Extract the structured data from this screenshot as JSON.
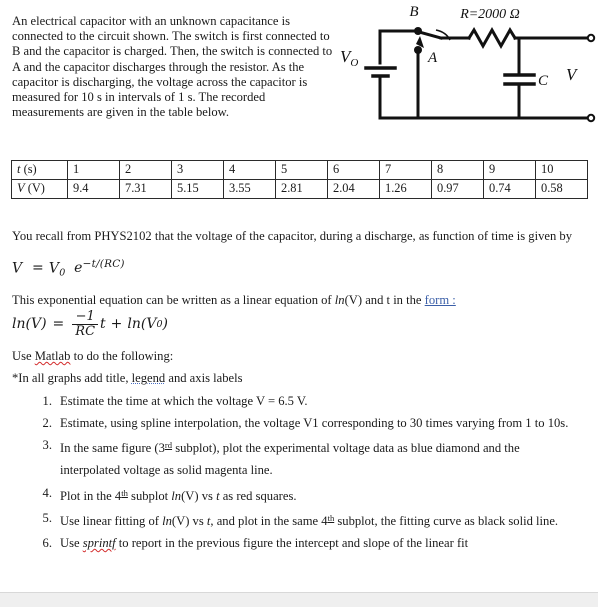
{
  "intro": {
    "paragraph": "An electrical capacitor with an unknown capacitance is connected to the circuit shown. The switch is first connected to B and the capacitor is charged. Then, the switch is connected to A and the capacitor discharges through the resistor. As the capacitor is discharging, the voltage across the capacitor is measured for 10 s in intervals of 1 s. The recorded measurements are given in the table below."
  },
  "circuit": {
    "source_label": "V",
    "source_sub": "O",
    "node_b": "B",
    "node_a": "A",
    "resistor_label": "R=2000 Ω",
    "capacitor_label": "C",
    "output_label": "V"
  },
  "table": {
    "row_headers": [
      "t (s)",
      "V (V)"
    ],
    "time_header_var": "t",
    "time_header_unit": "(s)",
    "volt_header_var": "V",
    "volt_header_unit": "(V)",
    "times": [
      "1",
      "2",
      "3",
      "4",
      "5",
      "6",
      "7",
      "8",
      "9",
      "10"
    ],
    "voltages": [
      "9.4",
      "7.31",
      "5.15",
      "3.55",
      "2.81",
      "2.04",
      "1.26",
      "0.97",
      "0.74",
      "0.58"
    ]
  },
  "text": {
    "recall": "You recall from PHYS2102 that the voltage of the capacitor, during a discharge, as function of time is given by",
    "linear_intro_a": "This exponential equation can be written as a linear equation of ",
    "linear_intro_ln": "ln",
    "linear_intro_b": "(V) and t in the ",
    "linear_intro_link": "form :",
    "use_matlab_a": "Use ",
    "use_matlab_word": "Matlab",
    "use_matlab_b": " to do the following:",
    "all_graphs_a": "*In all graphs add title, ",
    "all_graphs_word": "legend",
    "all_graphs_b": " and axis labels"
  },
  "equations": {
    "exponential": {
      "lhs": "V",
      "eq": "=",
      "v0": "V",
      "v0_sub": "0",
      "e": "e",
      "exponent": "−t/(RC)"
    },
    "linear": {
      "ln1": "ln",
      "lhs_arg": "(V)",
      "eq": "=",
      "numerator": "−1",
      "denominator": "RC",
      "t": "t",
      "plus": "+",
      "ln2": "ln",
      "rhs_arg_open": "(V",
      "rhs_sub": "0",
      "rhs_arg_close": ")"
    }
  },
  "tasks": [
    {
      "num": "1.",
      "parts": [
        {
          "t": "Estimate the time at which the voltage V = 6.5 V.",
          "s": "plain"
        }
      ]
    },
    {
      "num": "2.",
      "parts": [
        {
          "t": "Estimate, using spline interpolation, the voltage V1 corresponding to 30 times varying from 1 to 10s.",
          "s": "plain"
        }
      ]
    },
    {
      "num": "3.",
      "parts": [
        {
          "t": "In the same figure (3",
          "s": "plain"
        },
        {
          "t": "rd",
          "s": "sup-ul"
        },
        {
          "t": " subplot), plot the experimental voltage data as blue diamond and the interpolated voltage as solid magenta line.",
          "s": "plain"
        }
      ]
    },
    {
      "num": "4.",
      "parts": [
        {
          "t": "Plot in the 4",
          "s": "plain"
        },
        {
          "t": "th",
          "s": "sup-ul"
        },
        {
          "t": " subplot ",
          "s": "plain"
        },
        {
          "t": "ln",
          "s": "ital"
        },
        {
          "t": "(V) vs ",
          "s": "plain"
        },
        {
          "t": "t",
          "s": "ital"
        },
        {
          "t": " as red squares.",
          "s": "plain"
        }
      ]
    },
    {
      "num": "5.",
      "parts": [
        {
          "t": "Use linear fitting of ",
          "s": "plain"
        },
        {
          "t": "ln",
          "s": "ital"
        },
        {
          "t": "(V) vs ",
          "s": "plain"
        },
        {
          "t": "t",
          "s": "ital"
        },
        {
          "t": ", and plot in the same 4",
          "s": "plain"
        },
        {
          "t": "th",
          "s": "sup-ul"
        },
        {
          "t": " subplot, the fitting curve as black solid line.",
          "s": "plain"
        }
      ]
    },
    {
      "num": "6.",
      "parts": [
        {
          "t": "Use ",
          "s": "plain"
        },
        {
          "t": "sprintf",
          "s": "ital-sp-red"
        },
        {
          "t": " to report in the previous figure the intercept and slope of the linear fit",
          "s": "plain"
        }
      ]
    }
  ],
  "colors": {
    "link": "#3b5fa8",
    "spell_red": "#d32b2b",
    "spell_blue": "#4a6fc4",
    "ink": "#1a1a1a",
    "bottom_bar": "#efefef"
  }
}
